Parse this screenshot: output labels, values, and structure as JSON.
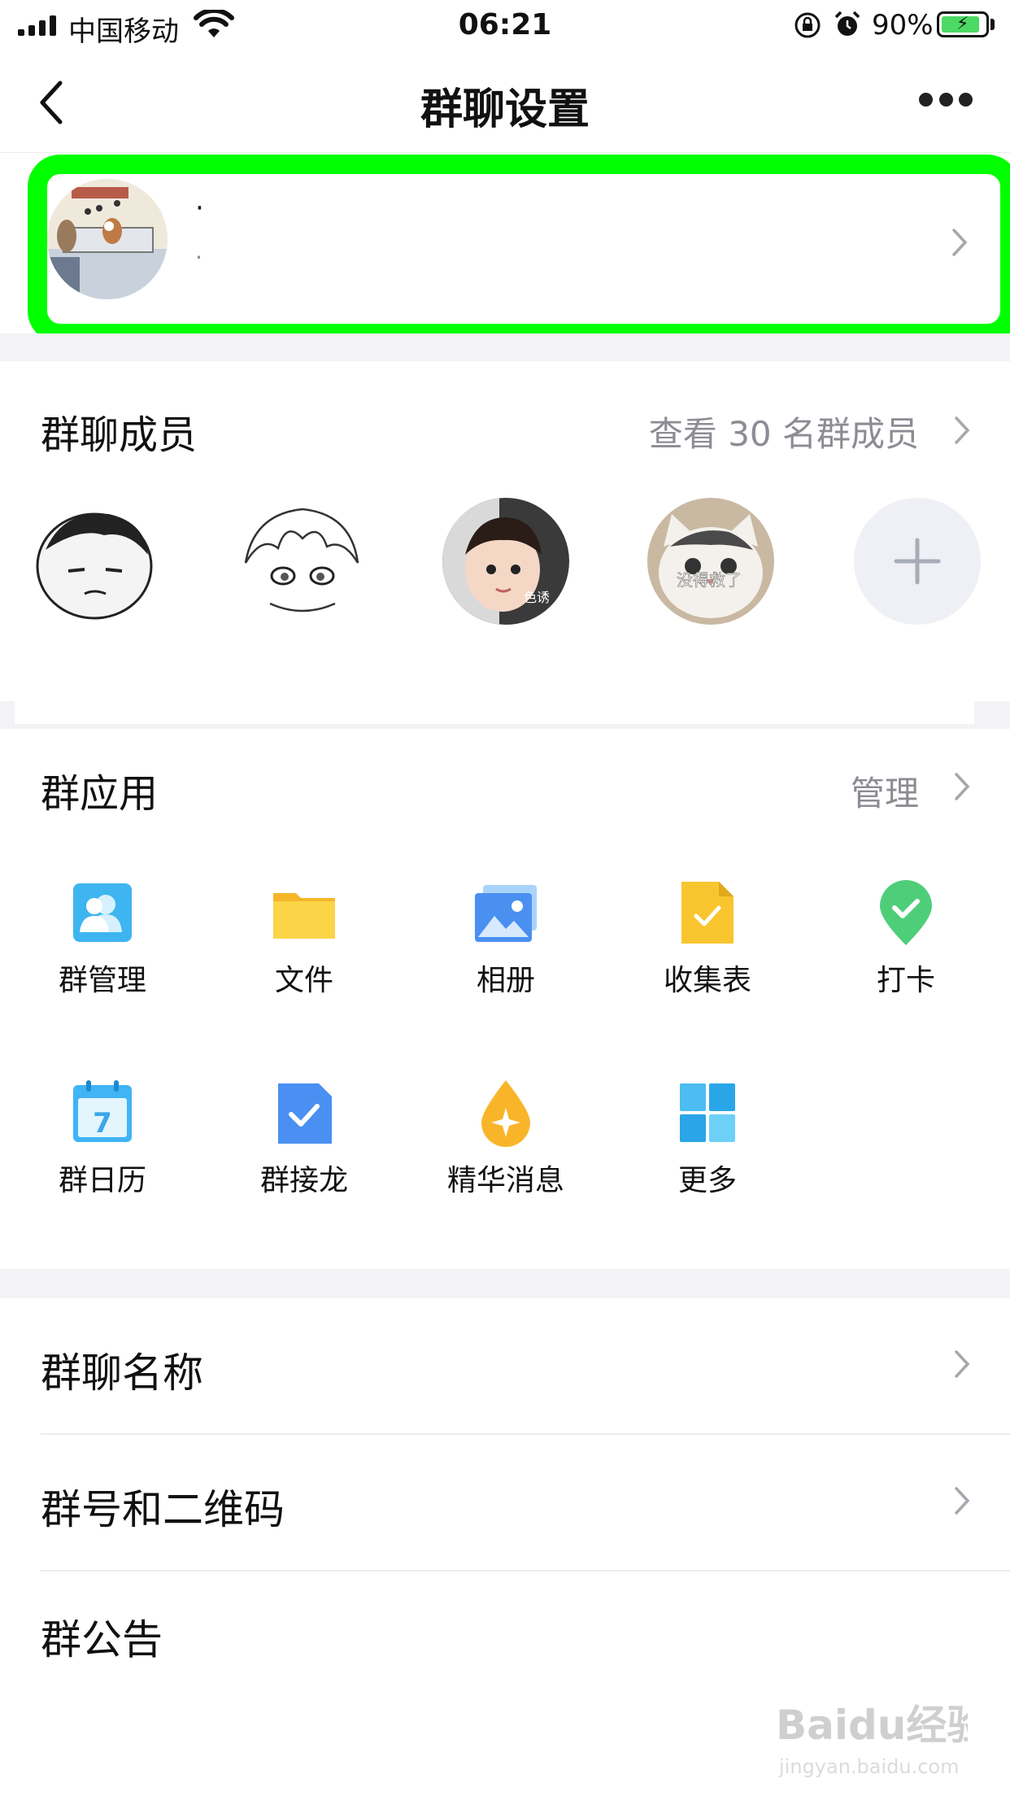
{
  "status_bar": {
    "carrier": "中国移动",
    "time": "06:21",
    "battery": "90%"
  },
  "nav": {
    "title": "群聊设置"
  },
  "group": {
    "name": "·",
    "subtitle": "·"
  },
  "members": {
    "title": "群聊成员",
    "view_all": "查看 30 名群成员"
  },
  "apps": {
    "title": "群应用",
    "manage": "管理",
    "items": [
      {
        "label": "群管理",
        "icon": "group-manage-icon"
      },
      {
        "label": "文件",
        "icon": "folder-icon"
      },
      {
        "label": "相册",
        "icon": "album-icon"
      },
      {
        "label": "收集表",
        "icon": "form-icon"
      },
      {
        "label": "打卡",
        "icon": "checkin-icon"
      },
      {
        "label": "群日历",
        "icon": "calendar-icon"
      },
      {
        "label": "群接龙",
        "icon": "chain-icon"
      },
      {
        "label": "精华消息",
        "icon": "essence-icon"
      },
      {
        "label": "更多",
        "icon": "more-apps-icon"
      }
    ]
  },
  "settings": {
    "group_name_label": "群聊名称",
    "group_qr_label": "群号和二维码",
    "announcement_label": "群公告"
  },
  "member_avatar_text": {
    "baby": "色诱",
    "cat": "没得救了"
  },
  "calendar_day": "7",
  "watermark": {
    "brand": "Baidu经验",
    "url": "jingyan.baidu.com"
  },
  "colors": {
    "highlight": "#00ff00",
    "accent_blue": "#3ea0f5",
    "yellow": "#f7c42e",
    "green": "#4fce7a"
  }
}
